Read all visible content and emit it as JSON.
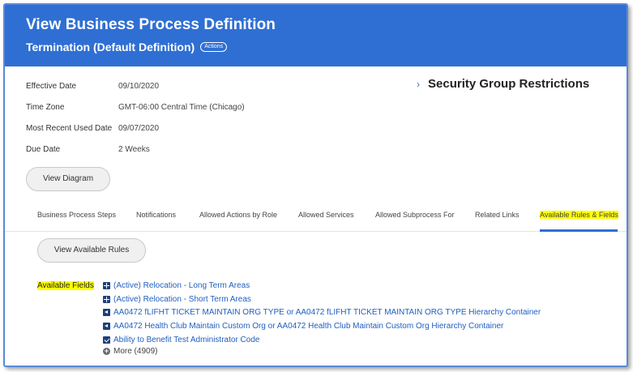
{
  "header": {
    "title": "View Business Process Definition",
    "subtitle": "Termination (Default Definition)",
    "actions_label": "Actions",
    "background": "#2f6fd3"
  },
  "details": [
    {
      "label": "Effective Date",
      "value": "09/10/2020"
    },
    {
      "label": "Time Zone",
      "value": "GMT-06:00 Central Time (Chicago)"
    },
    {
      "label": "Most Recent Used Date",
      "value": "09/07/2020"
    },
    {
      "label": "Due Date",
      "value": "2 Weeks"
    }
  ],
  "security_group_restrictions": {
    "icon": "chevron-right-icon",
    "label": "Security Group Restrictions"
  },
  "view_diagram_label": "View Diagram",
  "tabs": [
    {
      "label": "Business Process Steps",
      "active": false
    },
    {
      "label": "Notifications",
      "active": false
    },
    {
      "label": "Allowed Actions by Role",
      "active": false
    },
    {
      "label": "Allowed Services",
      "active": false
    },
    {
      "label": "Allowed Subprocess For",
      "active": false
    },
    {
      "label": "Related Links",
      "active": false
    },
    {
      "label": "Available Rules & Fields",
      "active": true
    }
  ],
  "view_available_rules_label": "View Available Rules",
  "available_fields": {
    "label": "Available Fields",
    "items": [
      {
        "icon": "grid-icon",
        "text": "(Active) Relocation - Long Term Areas"
      },
      {
        "icon": "grid-icon",
        "text": "(Active) Relocation - Short Term Areas"
      },
      {
        "icon": "arrow-left-icon",
        "text": "AA0472 fLIFHT TICKET MAINTAIN ORG TYPE or AA0472 fLIFHT TICKET MAINTAIN ORG TYPE Hierarchy Container"
      },
      {
        "icon": "arrow-left-icon",
        "text": "AA0472 Health Club Maintain Custom Org or AA0472 Health Club Maintain Custom Org Hierarchy Container"
      },
      {
        "icon": "checkbox-icon",
        "text": "Ability to Benefit Test Administrator Code"
      }
    ],
    "more_label": "More (4909)"
  },
  "colors": {
    "accent": "#2f6fd3",
    "link": "#1f5fbf",
    "highlight": "#ffff00"
  }
}
